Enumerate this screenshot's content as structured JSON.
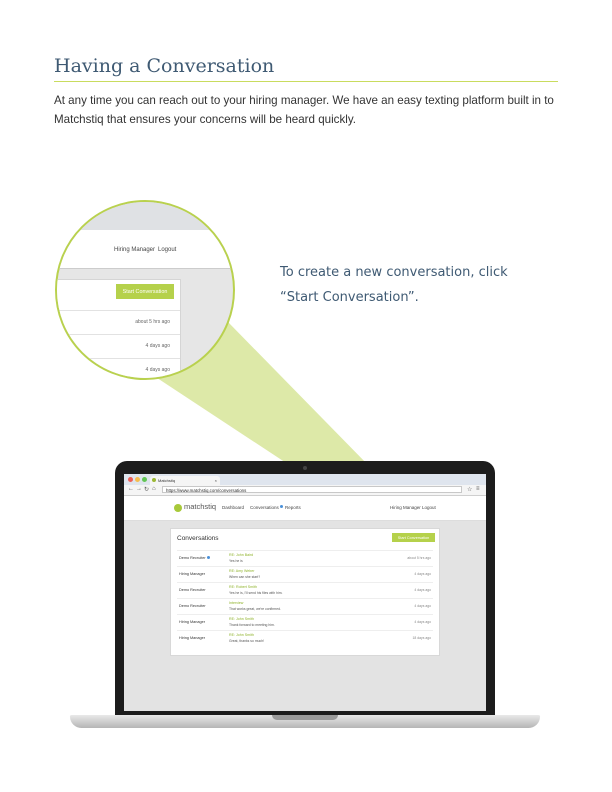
{
  "heading": "Having a Conversation",
  "intro": "At any time you can reach out to your hiring manager. We have an easy texting platform built in to Matchstiq that ensures your concerns will be heard quickly.",
  "callout": {
    "line1": "To create a new conversation, click",
    "line2": "“Start Conversation”."
  },
  "colors": {
    "accent": "#b5d14b",
    "heading": "#3f5a73",
    "rule": "#c9dc5e",
    "beam": "#dde9a8"
  },
  "screen": {
    "tab_title": "Matchstiq",
    "tab_close": "×",
    "url": "https://www.matchstiq.com/conversations",
    "logo": "matchstiq",
    "nav": [
      "Dashboard",
      "Conversations",
      "Reports"
    ],
    "user": {
      "role": "Hiring Manager",
      "logout": "Logout"
    },
    "title": "Conversations",
    "button": "Start Conversation",
    "rows": [
      {
        "from": "Demo Recruiter",
        "unread": true,
        "subject": "RE: John Baird",
        "preview": "Yes he is",
        "time": "about 5 hrs ago"
      },
      {
        "from": "Hiring Manager",
        "unread": false,
        "subject": "RE: Amy Weber",
        "preview": "When can she start?",
        "time": "4 days ago"
      },
      {
        "from": "Demo Recruiter",
        "unread": false,
        "subject": "RE: Robert Smith",
        "preview": "Yes he is, I'll send his files with him.",
        "time": "4 days ago"
      },
      {
        "from": "Demo Recruiter",
        "unread": false,
        "subject": "Interview",
        "preview": "That works great, we're confirmed.",
        "time": "4 days ago"
      },
      {
        "from": "Hiring Manager",
        "unread": false,
        "subject": "RE: John Smith",
        "preview": "Thank forward to meeting him.",
        "time": "4 days ago"
      },
      {
        "from": "Hiring Manager",
        "unread": false,
        "subject": "RE: John Smith",
        "preview": "Great, thanks so much!",
        "time": "18 days ago"
      }
    ]
  },
  "magnifier": {
    "role": "Hiring Manager",
    "logout": "Logout",
    "button": "Start Conversation",
    "times": [
      "about 5 hrs ago",
      "4 days ago",
      "4 days ago"
    ]
  }
}
